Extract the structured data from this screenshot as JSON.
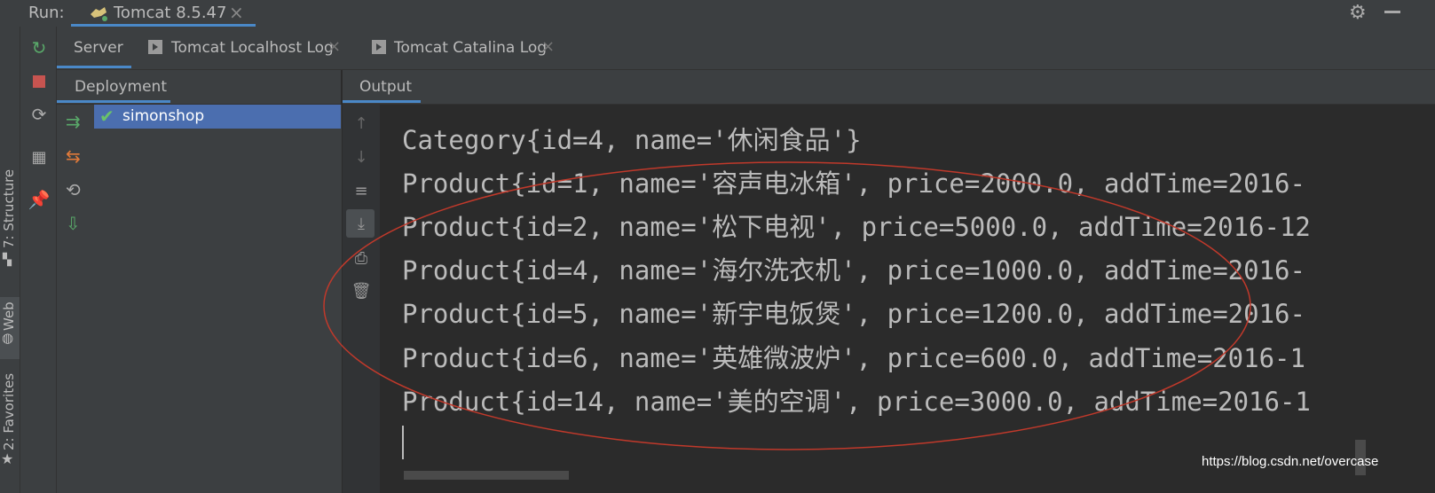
{
  "runbar": {
    "label": "Run:",
    "tab_label": "Tomcat 8.5.47",
    "tab_close": "×",
    "gear_icon": "gear-icon",
    "minimize_icon": "minimize-icon"
  },
  "left_strip": {
    "tabs": [
      {
        "label": "7: Structure"
      },
      {
        "label": "Web"
      },
      {
        "label": "2: Favorites"
      }
    ]
  },
  "run_toolbar": {
    "icons": [
      "rerun-icon",
      "stop-icon",
      "update-icon",
      "layout-icon",
      "pin-icon"
    ]
  },
  "server_tabs": [
    {
      "label": "Server"
    },
    {
      "label": "Tomcat Localhost Log",
      "close": "×"
    },
    {
      "label": "Tomcat Catalina Log",
      "close": "×"
    }
  ],
  "deployment": {
    "header": "Deployment",
    "items": [
      {
        "label": "simonshop",
        "status": "deployed"
      }
    ]
  },
  "output": {
    "header": "Output",
    "lines": [
      "Category{id=4, name='休闲食品'}",
      "Product{id=1, name='容声电冰箱', price=2000.0, addTime=2016-",
      "Product{id=2, name='松下电视', price=5000.0, addTime=2016-12",
      "Product{id=4, name='海尔洗衣机', price=1000.0, addTime=2016-",
      "Product{id=5, name='新宇电饭煲', price=1200.0, addTime=2016-",
      "Product{id=6, name='英雄微波炉', price=600.0, addTime=2016-1",
      "Product{id=14, name='美的空调', price=3000.0, addTime=2016-1"
    ]
  },
  "colors": {
    "accent": "#4a88c7",
    "selection": "#4b6eaf",
    "annotation": "#c0392b"
  },
  "watermark": "https://blog.csdn.net/overcase"
}
